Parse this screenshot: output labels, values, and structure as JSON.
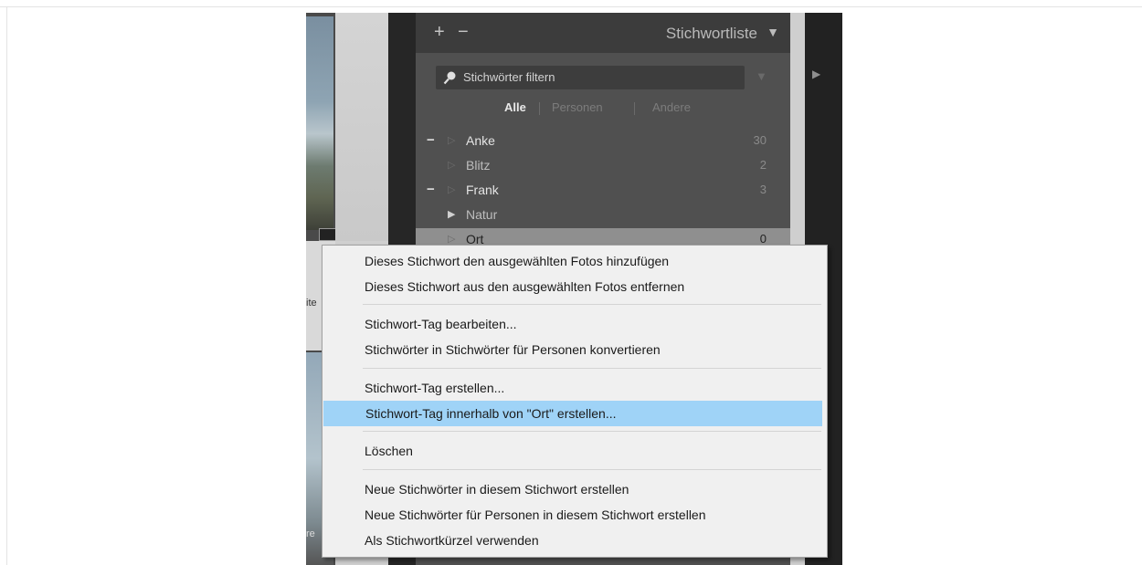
{
  "panel": {
    "title": "Stichwortliste",
    "add_symbol": "+",
    "remove_symbol": "−",
    "collapse_symbol": "▼",
    "filter_placeholder": "Stichwörter filtern",
    "tabs": [
      "Alle",
      "Personen",
      "Andere"
    ],
    "active_tab": "Alle",
    "keywords": [
      {
        "label": "Anke",
        "count": "30",
        "checked": true
      },
      {
        "label": "Blitz",
        "count": "2",
        "checked": false
      },
      {
        "label": "Frank",
        "count": "3",
        "checked": true
      },
      {
        "label": "Natur",
        "count": "",
        "checked": false
      },
      {
        "label": "Ort",
        "count": "0",
        "checked": false
      }
    ]
  },
  "side": {
    "text_1": "ite",
    "text_2": "re"
  },
  "context_menu": {
    "items": [
      "Dieses Stichwort den ausgewählten Fotos hinzufügen",
      "Dieses Stichwort aus den ausgewählten Fotos entfernen",
      "Stichwort-Tag bearbeiten...",
      "Stichwörter in Stichwörter für Personen konvertieren",
      "Stichwort-Tag erstellen...",
      "Stichwort-Tag innerhalb von \"Ort\" erstellen...",
      "Löschen",
      "Neue Stichwörter in diesem Stichwort erstellen",
      "Neue Stichwörter für Personen in diesem Stichwort erstellen",
      "Als Stichwortkürzel verwenden"
    ],
    "highlighted": "Stichwort-Tag innerhalb von \"Ort\" erstellen...",
    "highlight_color": "#9fd3f7"
  },
  "colors": {
    "panel_bg": "#505050",
    "menu_bg": "#f0f0f0"
  }
}
